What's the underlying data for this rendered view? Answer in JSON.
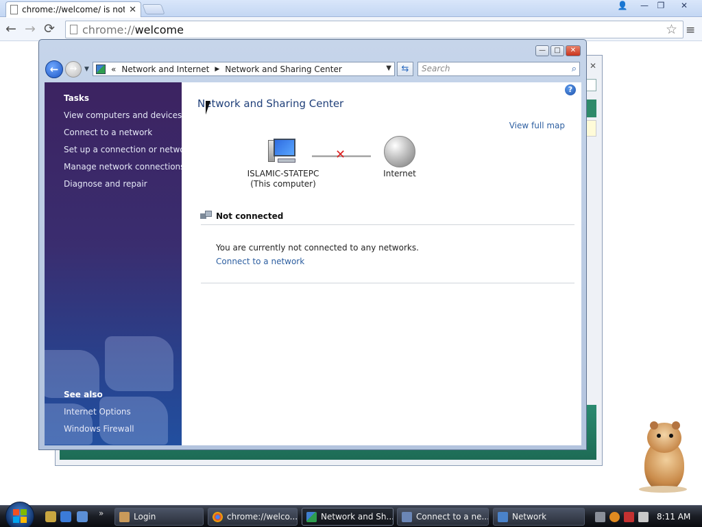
{
  "chrome": {
    "tab_title": "chrome://welcome/ is not",
    "tab_close": "✕",
    "url_scheme": "chrome://",
    "url_host": "welcome",
    "back": "←",
    "forward": "→",
    "reload": "⟳",
    "star": "☆",
    "menu": "≡",
    "win_user": "👤",
    "win_min": "—",
    "win_restore": "❐",
    "win_close": "✕"
  },
  "nsc_window": {
    "caption_min": "—",
    "caption_max": "□",
    "caption_close": "✕",
    "back_glyph": "←",
    "forward_glyph": "→",
    "history_glyph": "▼",
    "address": {
      "chevron": "«",
      "crumb1": "Network and Internet",
      "sep": "▶",
      "crumb2": "Network and Sharing Center",
      "dropdown": "▼"
    },
    "refresh_glyph": "⇆",
    "search_placeholder": "Search",
    "search_glyph": "⌕",
    "sidebar": {
      "tasks_heading": "Tasks",
      "tasks": [
        "View computers and devices",
        "Connect to a network",
        "Set up a connection or network",
        "Manage network connections",
        "Diagnose and repair"
      ],
      "see_also_heading": "See also",
      "see_also": [
        "Internet Options",
        "Windows Firewall"
      ]
    },
    "content": {
      "help_glyph": "?",
      "title": "Network and Sharing Center",
      "view_full_map": "View full map",
      "computer_name": "ISLAMIC-STATEPC",
      "computer_sub": "(This computer)",
      "disconnect_glyph": "✕",
      "internet_label": "Internet",
      "status_title": "Not connected",
      "status_message": "You are currently not connected to any networks.",
      "connect_link": "Connect to a network"
    }
  },
  "bg_window": {
    "close": "✕"
  },
  "taskbar": {
    "more": "»",
    "tasks": [
      "Login",
      "chrome://welco...",
      "Network and Sh...",
      "Connect to a ne...",
      "Network"
    ],
    "clock": "8:11 AM"
  },
  "colors": {
    "sidebar_top": "#3c2361",
    "sidebar_bottom": "#224f9f",
    "link": "#2c5ea0",
    "title": "#1f3f79",
    "disconnect": "#dd2222"
  }
}
